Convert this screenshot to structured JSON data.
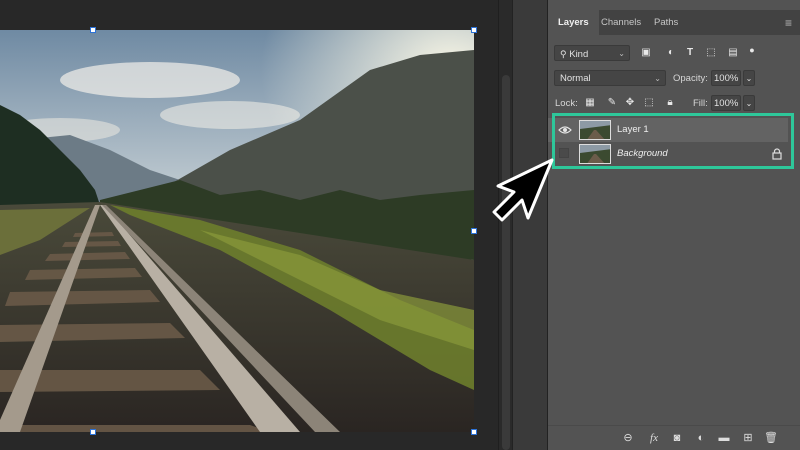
{
  "panel": {
    "tabs": [
      {
        "label": "Layers",
        "active": true
      },
      {
        "label": "Channels",
        "active": false
      },
      {
        "label": "Paths",
        "active": false
      }
    ],
    "menu_icon": "hamburger-menu-icon",
    "filter": {
      "label": "Kind"
    },
    "blend_mode": "Normal",
    "opacity_label": "Opacity:",
    "opacity_value": "100%",
    "lock_label": "Lock:",
    "fill_label": "Fill:",
    "fill_value": "100%",
    "layers": [
      {
        "name": "Layer 1",
        "visible": true,
        "selected": true,
        "locked": false
      },
      {
        "name": "Background",
        "visible": false,
        "selected": false,
        "locked": true
      }
    ],
    "bottom_icons": [
      "link-icon",
      "fx-icon",
      "mask-icon",
      "adjustment-icon",
      "group-folder-icon",
      "new-layer-icon",
      "trash-icon"
    ]
  },
  "highlight_color": "#2ec79a",
  "canvas": {
    "image": "railway-tracks-mountain-landscape-photo"
  }
}
